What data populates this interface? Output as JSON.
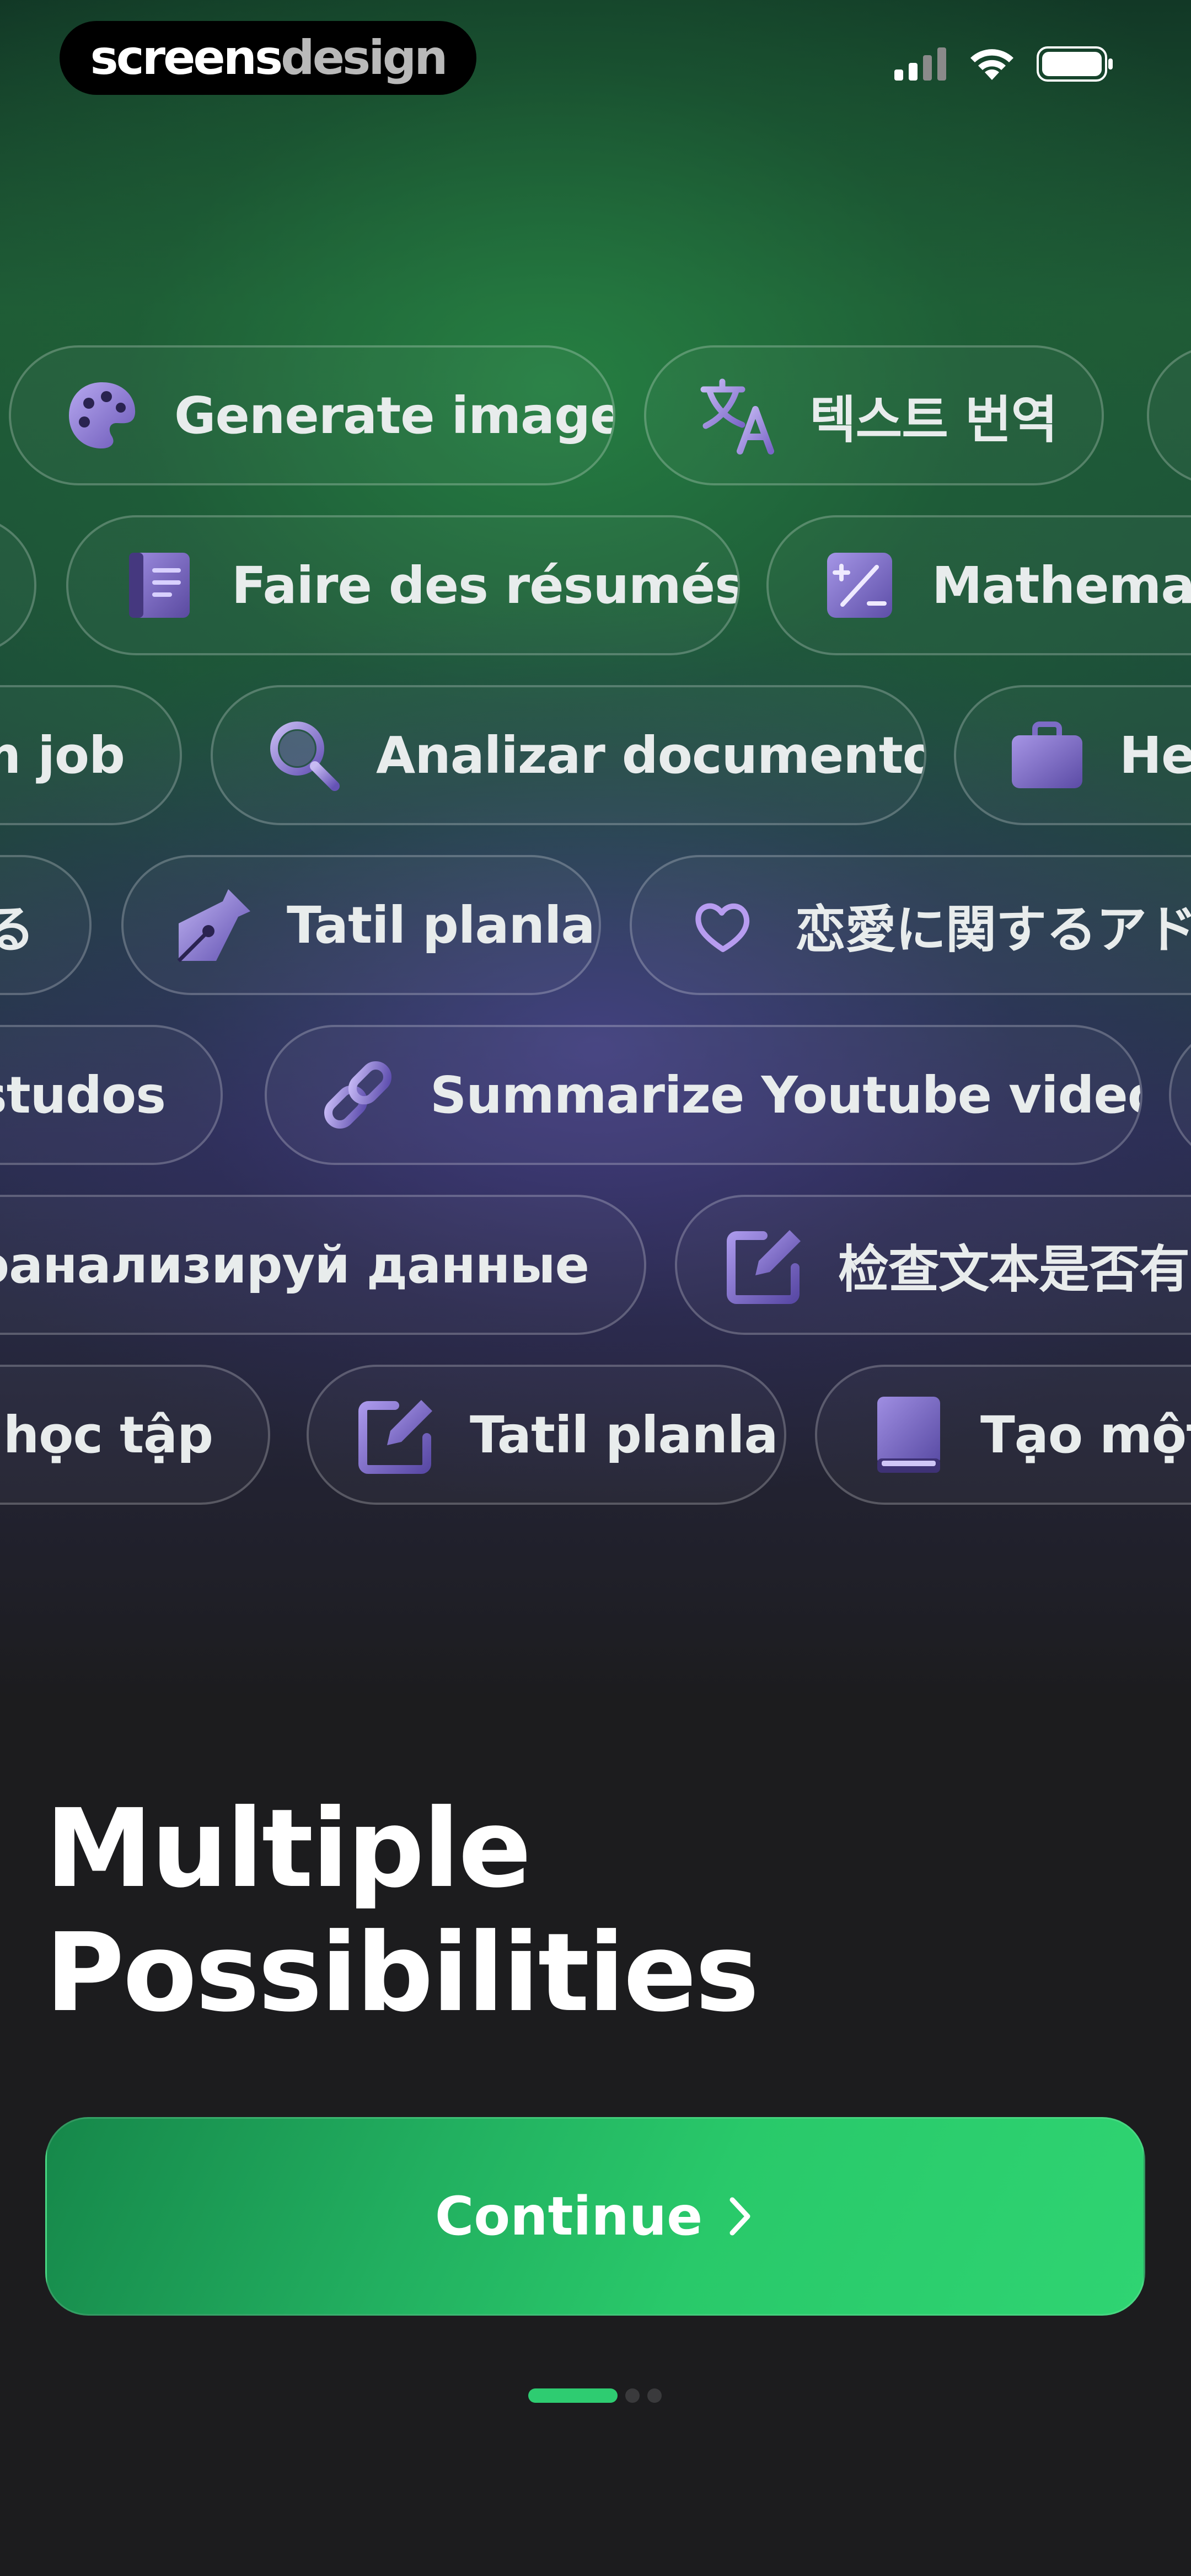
{
  "status_bar": {
    "brand_main": "screens",
    "brand_dim": "design",
    "icons": [
      "cellular-signal-icon",
      "wifi-icon",
      "battery-icon"
    ]
  },
  "chips": {
    "row1": [
      {
        "label": "Generate image",
        "icon": "palette-icon"
      },
      {
        "label": "텍스트 번역",
        "icon": "translate-icon"
      }
    ],
    "row2": [
      {
        "label": "Faire des résumés",
        "icon": "notebook-icon"
      },
      {
        "label": "Mathemati",
        "icon": "calculator-icon"
      }
    ],
    "row3": [
      {
        "label": "m job",
        "icon": ""
      },
      {
        "label": "Analizar documento",
        "icon": "magnifier-icon"
      },
      {
        "label": "Hel",
        "icon": "briefcase-icon"
      }
    ],
    "row4": [
      {
        "label": "る",
        "icon": ""
      },
      {
        "label": "Tatil planla",
        "icon": "pen-nib-icon"
      },
      {
        "label": "恋愛に関するアド",
        "icon": "heart-icon"
      }
    ],
    "row5": [
      {
        "label": "studos",
        "icon": ""
      },
      {
        "label": "Summarize Youtube video",
        "icon": "link-icon"
      }
    ],
    "row6": [
      {
        "label": "Проанализируй данные",
        "icon": ""
      },
      {
        "label": "检查文本是否有",
        "icon": "edit-icon"
      }
    ],
    "row7": [
      {
        "label": "n học tập",
        "icon": ""
      },
      {
        "label": "Tatil planla",
        "icon": "edit-icon"
      },
      {
        "label": "Tạo một k",
        "icon": "book-icon"
      }
    ]
  },
  "title": {
    "line1": "Multiple",
    "line2": "Possibilities"
  },
  "cta": {
    "label": "Continue",
    "icon": "chevron-right-icon",
    "color": "#2ecc71"
  },
  "pager": {
    "count": 3,
    "active_index": 0
  }
}
